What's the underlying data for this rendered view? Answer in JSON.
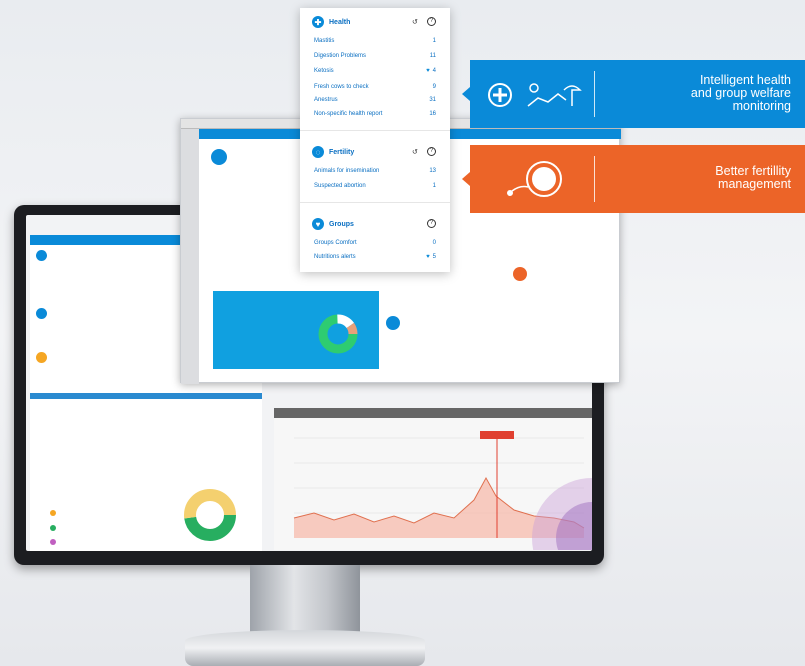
{
  "health": {
    "title": "Health",
    "rows": [
      {
        "label": "Mastitis",
        "value": "1",
        "alert": false
      },
      {
        "label": "Digestion Problems",
        "value": "11",
        "alert": false
      },
      {
        "label": "Ketosis",
        "value": "4",
        "alert": true
      },
      {
        "label": "Fresh cows to check",
        "value": "9",
        "alert": false
      },
      {
        "label": "Anestrus",
        "value": "31",
        "alert": false
      },
      {
        "label": "Non-specific health report",
        "value": "16",
        "alert": false
      }
    ]
  },
  "fertility": {
    "title": "Fertility",
    "rows": [
      {
        "label": "Animals for insemination",
        "value": "13",
        "alert": false
      },
      {
        "label": "Suspected abortion",
        "value": "1",
        "alert": false
      }
    ]
  },
  "groups": {
    "title": "Groups",
    "rows": [
      {
        "label": "Groups Comfort",
        "value": "0",
        "alert": false
      },
      {
        "label": "Nutritions alerts",
        "value": "5",
        "alert": true
      }
    ]
  },
  "callouts": {
    "health_line1": "Intelligent health",
    "health_line2": "and group welfare",
    "health_line3": "monitoring",
    "fertility_line1": "Better fertillity",
    "fertility_line2": "management"
  },
  "icons": {
    "refresh": "↺",
    "help": "?",
    "alert": "heart-shield-icon"
  },
  "colors": {
    "brand_blue": "#0a8ad8",
    "brand_orange": "#ec6428"
  }
}
